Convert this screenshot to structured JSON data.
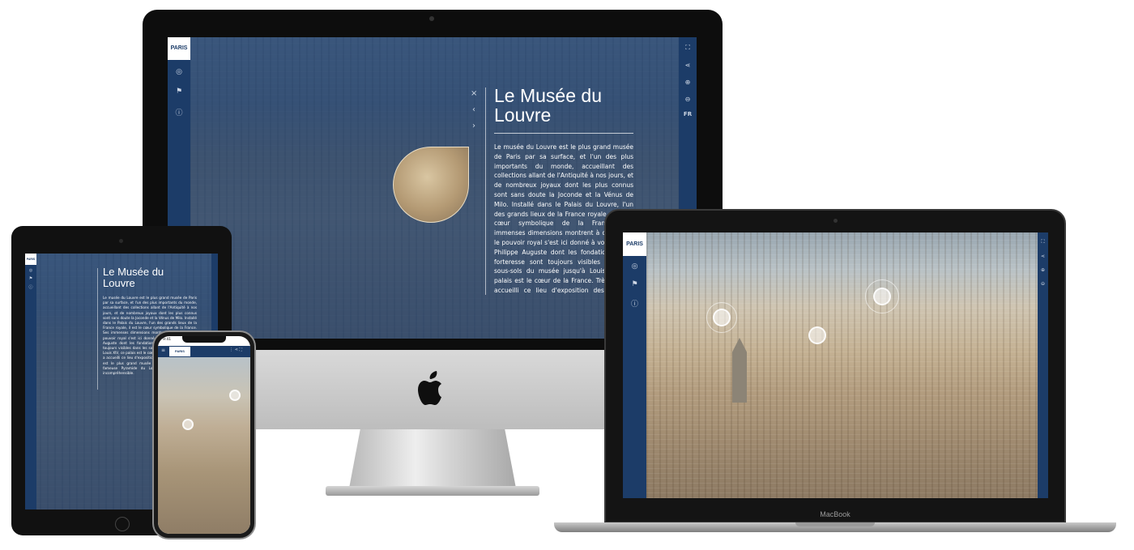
{
  "imac": {
    "logo": "PARIS",
    "title_line1": "Le Musée du",
    "title_line2": "Louvre",
    "paragraph": "Le musée du Louvre est le plus grand musée de Paris par sa surface, et l'un des plus importants du monde, accueillant des collections allant de l'Antiquité à nos jours, et de nombreux joyaux dont les plus connus sont sans doute la Joconde et la Vénus de Milo. Installé dans le Palais du Louvre, l'un des grands lieux de la France royale, il est le cœur symbolique de la France. Ses immenses dimensions montrent à quel point le pouvoir royal s'est ici donné à voir. Depuis Philippe Auguste dont les fondations de la forteresse sont toujours visibles dans les sous-sols du musée jusqu'à Louis XIV, ce palais est le cœur de la France. Très tôt, il a accueilli ce lieu d'exposition des arts du royaume... Il est le plus grand musée français dans",
    "lang": "FR",
    "close_glyph": "×",
    "prev_glyph": "‹",
    "next_glyph": "›"
  },
  "ipad": {
    "logo": "PARIS",
    "title_line1": "Le Musée du",
    "title_line2": "Louvre",
    "paragraph": "Le musée du Louvre est le plus grand musée de Paris par sa surface, et l'un des plus importants du monde, accueillant des collections allant de l'Antiquité à nos jours, et de nombreux joyaux dont les plus connus sont sans doute la Joconde et la Vénus de Milo. Installé dans le Palais du Louvre, l'un des grands lieux de la France royale, il est le cœur symbolique de la France. Ses immenses dimensions montrent à quel point le pouvoir royal s'est ici donné à voir. Depuis Philippe Auguste dont les fondations de la forteresse sont toujours visibles dans les sous-sols du musée jusqu'à Louis XIV, ce palais est le cœur de la France. Très tôt, il a accueilli ce lieu d'exposition des arts du royaume. Il est le plus grand musée français. Il construit la fameuse Pyramide du Louvre dont tout à fait incompréhensible."
  },
  "iphone": {
    "logo": "PARIS",
    "time": "9:41"
  },
  "macbook": {
    "logo": "PARIS",
    "brand": "MacBook"
  }
}
